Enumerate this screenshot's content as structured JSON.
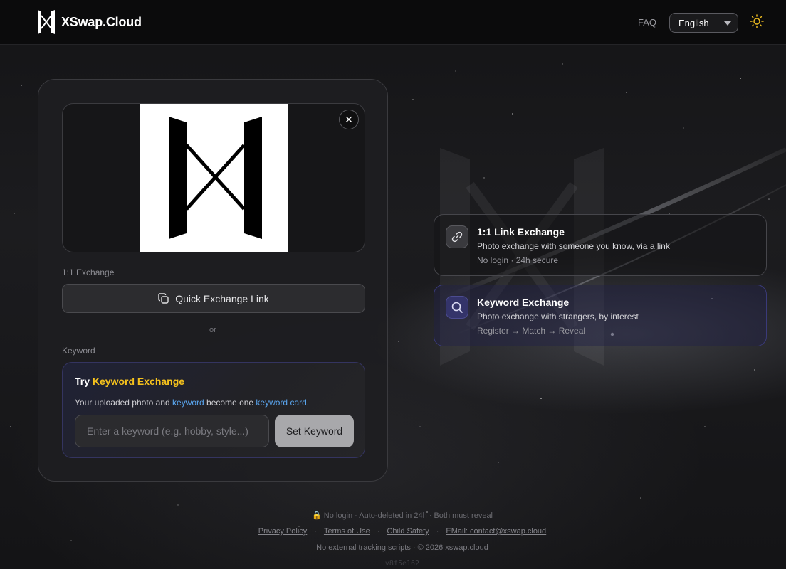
{
  "header": {
    "brand": "XSwap.Cloud",
    "faq": "FAQ",
    "language": "English"
  },
  "card": {
    "exchange_label": "1:1 Exchange",
    "quick_link_label": "Quick Exchange Link",
    "or_label": "or",
    "keyword_label": "Keyword",
    "keyword_box": {
      "title_prefix": "Try ",
      "title_highlight": "Keyword Exchange",
      "desc_part1": "Your uploaded photo and ",
      "desc_keyword": "keyword",
      "desc_part2": " become one ",
      "desc_card": "keyword card",
      "desc_end": ".",
      "input_placeholder": "Enter a keyword (e.g. hobby, style...)",
      "set_button": "Set Keyword"
    }
  },
  "features": [
    {
      "title": "1:1 Link Exchange",
      "desc": "Photo exchange with someone you know, via a link",
      "meta": "No login · 24h secure",
      "icon": "link-icon"
    },
    {
      "title": "Keyword Exchange",
      "desc": "Photo exchange with strangers, by interest",
      "meta": "Register → Match → Reveal",
      "icon": "search-icon"
    }
  ],
  "footer": {
    "note": "🔒 No login · Auto-deleted in 24h · Both must reveal",
    "links": {
      "privacy": "Privacy Policy",
      "terms": "Terms of Use",
      "child_safety": "Child Safety",
      "email": "EMail: contact@xswap.cloud"
    },
    "copyright": "No external tracking scripts · © 2026 xswap.cloud",
    "version": "v8f5e162"
  },
  "colors": {
    "accent_yellow": "#f6c21c",
    "accent_blue": "#5aa6f0",
    "background": "#141416"
  }
}
